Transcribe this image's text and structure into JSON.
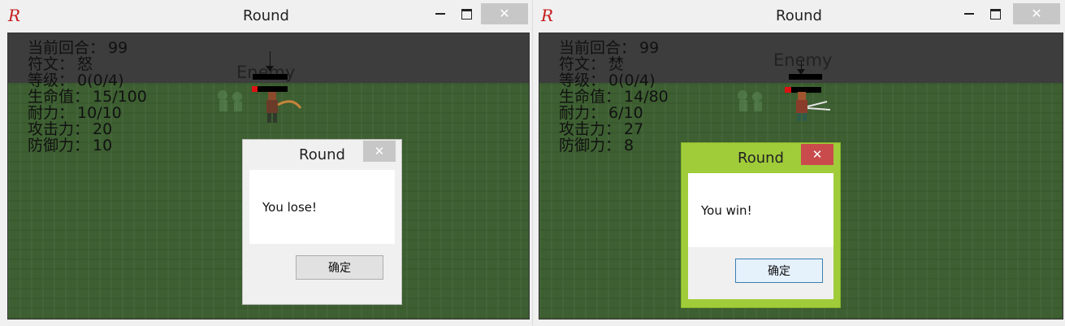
{
  "app": {
    "icon_letter": "R"
  },
  "windows": [
    {
      "title": "Round",
      "stats": {
        "round": {
          "label": "当前回合：",
          "value": "99"
        },
        "rune": {
          "label": "符文：",
          "value": "怒"
        },
        "level": {
          "label": "等级：",
          "value": "0(0/4)"
        },
        "hp": {
          "label": "生命值：",
          "value": "15/100"
        },
        "endurance": {
          "label": "耐力：",
          "value": "10/10"
        },
        "attack": {
          "label": "攻击力：",
          "value": "20"
        },
        "defense": {
          "label": "防御力：",
          "value": "10"
        }
      },
      "enemy_label": "Enemy",
      "dialog": {
        "title": "Round",
        "message": "You lose!",
        "ok_label": "确定",
        "close_glyph": "✕"
      }
    },
    {
      "title": "Round",
      "stats": {
        "round": {
          "label": "当前回合：",
          "value": "99"
        },
        "rune": {
          "label": "符文：",
          "value": "焚"
        },
        "level": {
          "label": "等级：",
          "value": "0(0/4)"
        },
        "hp": {
          "label": "生命值：",
          "value": "14/80"
        },
        "endurance": {
          "label": "耐力：",
          "value": "6/10"
        },
        "attack": {
          "label": "攻击力：",
          "value": "27"
        },
        "defense": {
          "label": "防御力：",
          "value": "8"
        }
      },
      "enemy_label": "Enemy",
      "dialog": {
        "title": "Round",
        "message": "You win!",
        "ok_label": "确定",
        "close_glyph": "✕"
      }
    }
  ],
  "window_controls": {
    "close_glyph": "✕"
  },
  "colors": {
    "grass": "#3d5f31",
    "sky": "#3d3d3d",
    "win_dialog": "#a0cc3a",
    "close_red": "#c94b4b",
    "hp_red": "#d11111"
  }
}
